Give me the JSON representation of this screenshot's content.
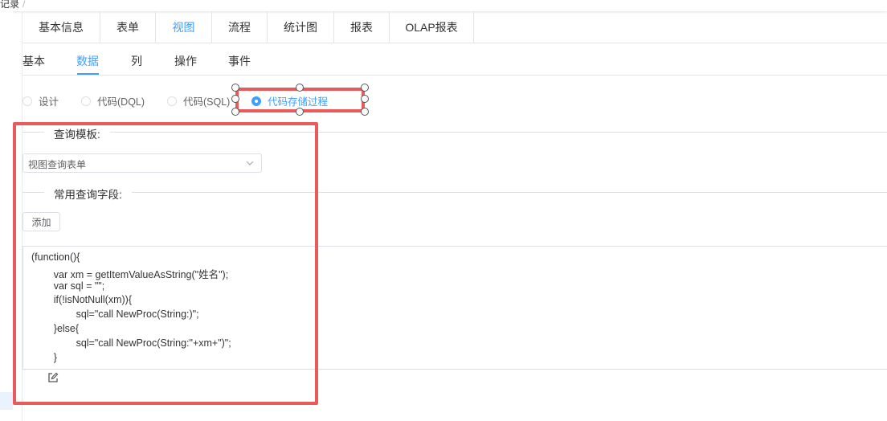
{
  "breadcrumb": {
    "text": "记录",
    "separator": "/"
  },
  "main_tabs": [
    {
      "label": "基本信息"
    },
    {
      "label": "表单"
    },
    {
      "label": "视图",
      "active": true
    },
    {
      "label": "流程"
    },
    {
      "label": "统计图"
    },
    {
      "label": "报表"
    },
    {
      "label": "OLAP报表"
    }
  ],
  "sub_tabs": [
    {
      "label": "基本"
    },
    {
      "label": "数据",
      "active": true
    },
    {
      "label": "列"
    },
    {
      "label": "操作"
    },
    {
      "label": "事件"
    }
  ],
  "data_mode": {
    "options": [
      {
        "label": "设计",
        "checked": false
      },
      {
        "label": "代码(DQL)",
        "checked": false
      },
      {
        "label": "代码(SQL)",
        "checked": false
      },
      {
        "label": "代码存储过程",
        "checked": true
      }
    ]
  },
  "query_template": {
    "section_label": "查询模板:",
    "selected": "视图查询表单"
  },
  "common_fields": {
    "section_label": "常用查询字段:",
    "add_label": "添加"
  },
  "code": {
    "lines": [
      "(function(){",
      "        var xm = getItemValueAsString(\"姓名\");",
      "        var sql = \"\";",
      "        if(!isNotNull(xm)){",
      "                sql=\"call NewProc(String:)\";",
      "        }else{",
      "                sql=\"call NewProc(String:\"+xm+\")\";",
      "        }",
      "                    ;"
    ]
  },
  "colors": {
    "accent": "#409eff",
    "annotation": "#e95a5a"
  },
  "icons": {
    "select_arrow": "chevron-down-icon",
    "edit": "edit-icon"
  }
}
